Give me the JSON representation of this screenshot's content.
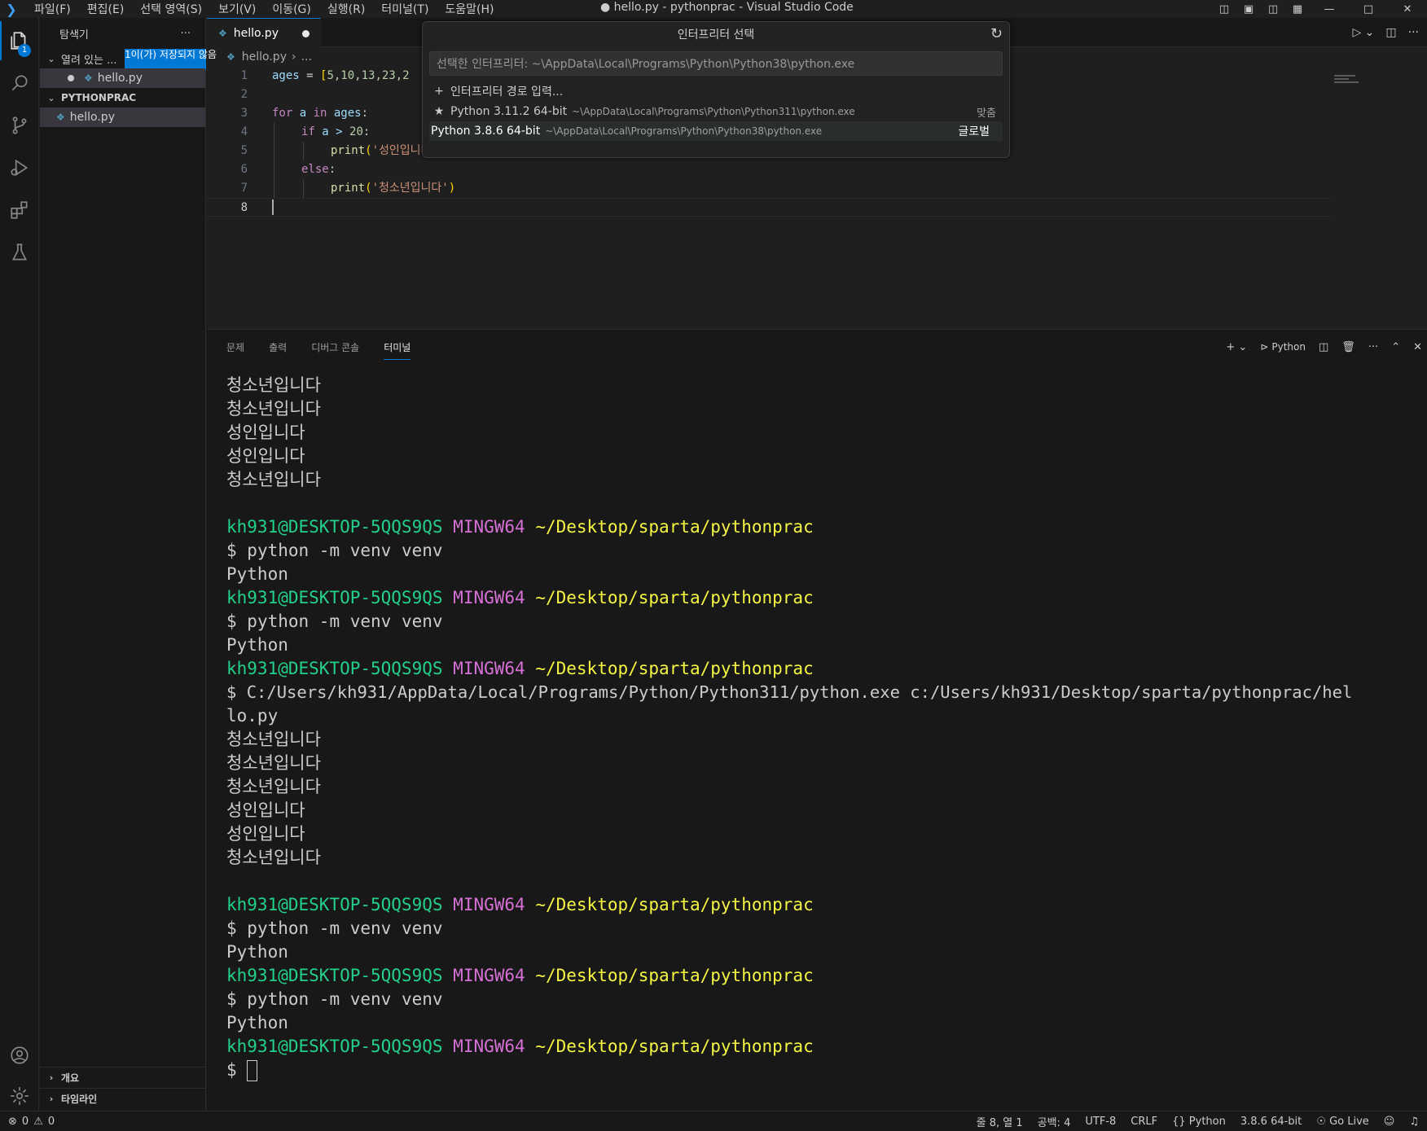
{
  "window": {
    "menu": [
      "파일(F)",
      "편집(E)",
      "선택 영역(S)",
      "보기(V)",
      "이동(G)",
      "실행(R)",
      "터미널(T)",
      "도움말(H)"
    ],
    "title": "● hello.py - pythonprac - Visual Studio Code"
  },
  "activity": {
    "explorer_badge": "1"
  },
  "sidebar": {
    "title": "탐색기",
    "more": "···",
    "open_editors_label": "열려 있는 ...",
    "unsaved_badge": "1이(가) 저장되지 않음",
    "open_file": "hello.py",
    "folder_label": "PYTHONPRAC",
    "folder_file": "hello.py",
    "outline_label": "개요",
    "timeline_label": "타임라인"
  },
  "editor": {
    "tab_label": "hello.py",
    "breadcrumb_file": "hello.py",
    "breadcrumb_more": "...",
    "line_numbers": [
      "1",
      "2",
      "3",
      "4",
      "5",
      "6",
      "7",
      "8"
    ],
    "lines": {
      "l1_var": "ages",
      "l1_eq": " = ",
      "l1_open": "[",
      "l1_nums": "5,10,13,23,2",
      "l3_for": "for",
      "l3_a": " a ",
      "l3_in": "in",
      "l3_ages": " ages",
      "l3_colon": ":",
      "l4_if": "if",
      "l4_cond": " a > ",
      "l4_num": "20",
      "l4_colon": ":",
      "l5_fn": "print",
      "l5_open": "(",
      "l5_str": "'성인입니다'",
      "l5_close": ")",
      "l6_else": "else",
      "l6_colon": ":",
      "l7_fn": "print",
      "l7_open": "(",
      "l7_str": "'청소년입니다'",
      "l7_close": ")"
    }
  },
  "quickpick": {
    "title": "인터프리터 선택",
    "input_placeholder": "선택한 인터프리터: ~\\AppData\\Local\\Programs\\Python\\Python38\\python.exe",
    "enter_path": "인터프리터 경로 입력...",
    "items": [
      {
        "label": "Python 3.11.2 64-bit",
        "path": "~\\AppData\\Local\\Programs\\Python\\Python311\\python.exe",
        "detail": "맞춤"
      },
      {
        "label": "Python 3.8.6 64-bit",
        "path": "~\\AppData\\Local\\Programs\\Python\\Python38\\python.exe",
        "detail": "글로벌"
      }
    ]
  },
  "panel": {
    "tabs": [
      "문제",
      "출력",
      "디버그 콘솔",
      "터미널"
    ],
    "terminal_name": "Python"
  },
  "terminal": {
    "teen": "청소년입니다",
    "adult": "성인입니다",
    "user_host": "kh931@DESKTOP-5QQS9QS",
    "mingw": "MINGW64",
    "cwd": "~/Desktop/sparta/pythonprac",
    "prompt": "$ ",
    "cmd_venv": "python -m venv venv",
    "out_python": "Python",
    "cmd_run_1": "C:/Users/kh931/AppData/Local/Programs/Python/Python311/python.exe c:/Users/kh931/Desktop/sparta/pythonprac/hel",
    "cmd_run_2": "lo.py"
  },
  "status": {
    "errors": "0",
    "warnings": "0",
    "position": "줄 8, 열 1",
    "spaces": "공백: 4",
    "encoding": "UTF-8",
    "eol": "CRLF",
    "language": "Python",
    "interpreter": "3.8.6 64-bit",
    "golive": "Go Live"
  }
}
